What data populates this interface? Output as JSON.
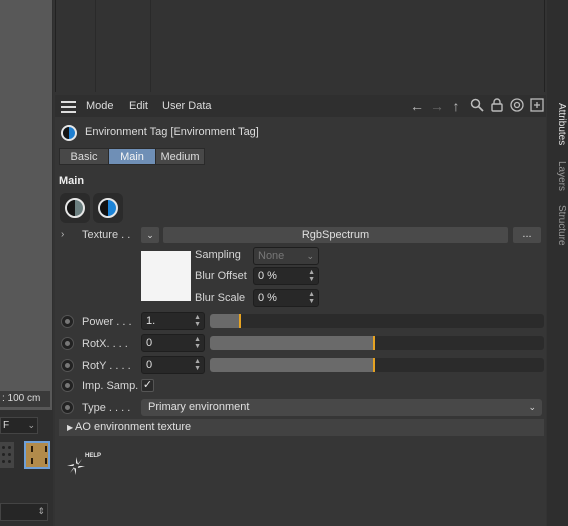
{
  "left": {
    "scale_readout": ": 100 cm",
    "dropdown_value": "F"
  },
  "side_tabs": [
    "Attributes",
    "Layers",
    "Structure"
  ],
  "menubar": {
    "items": [
      "Mode",
      "Edit",
      "User Data"
    ],
    "icons": [
      "arrow-left-icon",
      "arrow-right-icon",
      "arrow-up-icon",
      "search-icon",
      "lock-icon",
      "target-icon",
      "new-panel-icon"
    ]
  },
  "tag_header": {
    "title": "Environment Tag [Environment Tag]"
  },
  "tabs": [
    "Basic",
    "Main",
    "Medium"
  ],
  "active_tab": "Main",
  "section": {
    "title": "Main"
  },
  "texture": {
    "label": "Texture . .",
    "shader": "RgbSpectrum",
    "ellipsis": "...",
    "sampling_label": "Sampling",
    "sampling_value": "None",
    "blur_offset_label": "Blur Offset",
    "blur_offset_value": "0 %",
    "blur_scale_label": "Blur Scale",
    "blur_scale_value": "0 %"
  },
  "params": {
    "power": {
      "label": "Power . . .",
      "value": "1.",
      "slider_fraction": 0.09
    },
    "rotx": {
      "label": "RotX. . . .",
      "value": "0",
      "slider_fraction": 0.49
    },
    "roty": {
      "label": "RotY . . . .",
      "value": "0",
      "slider_fraction": 0.49
    },
    "imp_samp": {
      "label": "Imp. Samp.",
      "checked": true,
      "check_glyph": "✓"
    },
    "type": {
      "label": "Type . . . .",
      "value": "Primary environment"
    }
  },
  "group": {
    "label": "AO environment texture"
  },
  "help": {
    "label": "HELP"
  },
  "colors": {
    "active_tab": "#6f8fb6",
    "slider_handle": "#e6a322",
    "panel_bg": "#363636"
  }
}
